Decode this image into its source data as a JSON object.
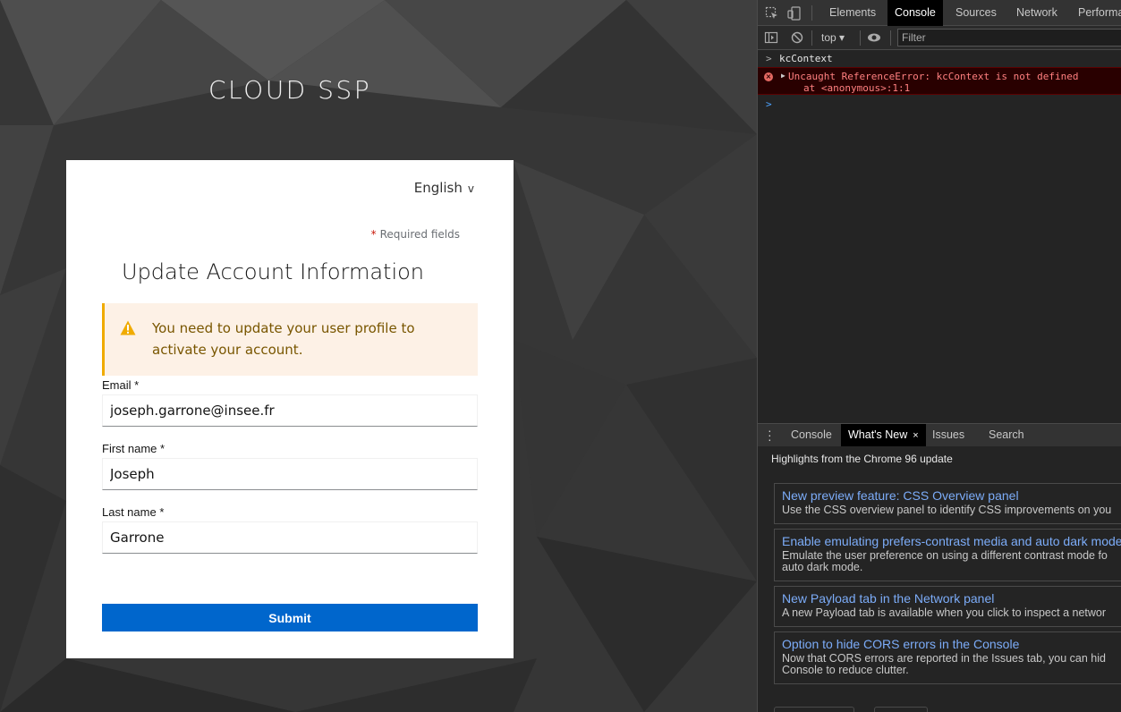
{
  "page": {
    "brand": "CLOUD SSP",
    "language": "English",
    "required_label": "Required fields",
    "required_marker": "*",
    "title": "Update Account Information",
    "alert": {
      "message": "You need to update your user profile to activate your account.",
      "icon": "warning-triangle-icon",
      "color": "#f0ab00"
    },
    "fields": {
      "email": {
        "label": "Email *",
        "value": "joseph.garrone@insee.fr"
      },
      "first_name": {
        "label": "First name *",
        "value": "Joseph"
      },
      "last_name": {
        "label": "Last name *",
        "value": "Garrone"
      }
    },
    "submit_label": "Submit",
    "accent": "#0066cc"
  },
  "devtools": {
    "tabs": [
      "Elements",
      "Console",
      "Sources",
      "Network",
      "Performa"
    ],
    "active_tab": "Console",
    "context": "top",
    "filter_placeholder": "Filter",
    "console": {
      "input_prompt": ">",
      "input": "kcContext",
      "error_line1": "Uncaught ReferenceError: kcContext is not defined",
      "error_line2": "at <anonymous>:1:1",
      "prompt": ">"
    },
    "drawer": {
      "tabs": [
        "Console",
        "What's New",
        "Issues",
        "Search"
      ],
      "active_tab": "What's New",
      "close": "×",
      "highlights": "Highlights from the Chrome 96 update",
      "items": [
        {
          "title": "New preview feature: CSS Overview panel",
          "desc": "Use the CSS overview panel to identify CSS improvements on you"
        },
        {
          "title": "Enable emulating prefers-contrast media and auto dark mode",
          "desc": "Emulate the user preference on using a different contrast mode fo",
          "desc2": "auto dark mode."
        },
        {
          "title": "New Payload tab in the Network panel",
          "desc": "A new Payload tab is available when you click to inspect a networ"
        },
        {
          "title": "Option to hide CORS errors in the Console",
          "desc": "Now that CORS errors are reported in the Issues tab, you can hid",
          "desc2": "Console to reduce clutter."
        }
      ]
    }
  }
}
